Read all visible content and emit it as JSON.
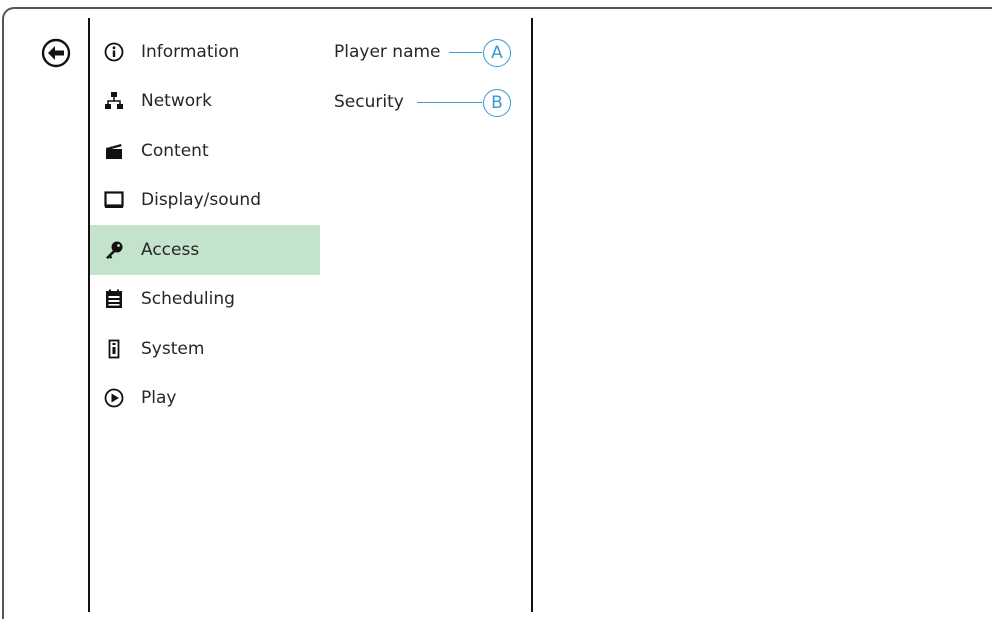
{
  "menu": {
    "items": [
      {
        "label": "Information",
        "icon": "info-icon"
      },
      {
        "label": "Network",
        "icon": "network-icon"
      },
      {
        "label": "Content",
        "icon": "clapperboard-icon"
      },
      {
        "label": "Display/sound",
        "icon": "monitor-icon"
      },
      {
        "label": "Access",
        "icon": "key-icon",
        "active": true
      },
      {
        "label": "Scheduling",
        "icon": "calendar-icon"
      },
      {
        "label": "System",
        "icon": "system-icon"
      },
      {
        "label": "Play",
        "icon": "play-icon"
      }
    ]
  },
  "submenu": {
    "items": [
      {
        "label": "Player name",
        "callout": "A"
      },
      {
        "label": "Security",
        "callout": "B"
      }
    ]
  },
  "colors": {
    "active_bg": "#c3e3cc",
    "callout": "#3a9ad0"
  }
}
